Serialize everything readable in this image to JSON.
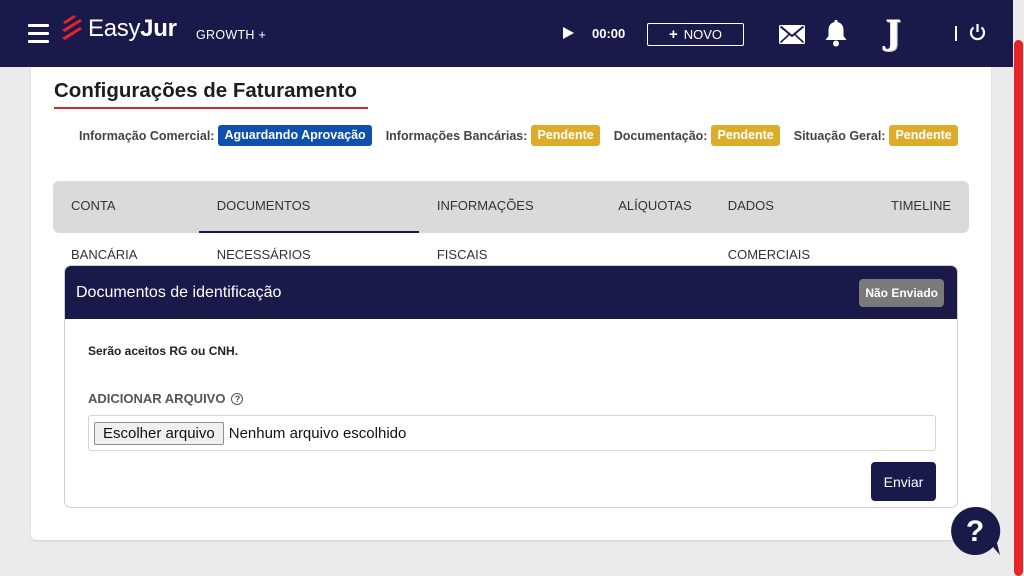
{
  "header": {
    "brand_light": "Easy",
    "brand_bold": "Jur",
    "plan": "GROWTH +",
    "timer": "00:00",
    "new_button": "NOVO",
    "new_plus": "+",
    "avatar_letter": "J",
    "icons": [
      "menu-icon",
      "play-icon",
      "mail-icon",
      "bell-icon",
      "power-icon"
    ]
  },
  "page": {
    "title": "Configurações de Faturamento"
  },
  "statuses": [
    {
      "label": "Informação Comercial:",
      "value": "Aguardando Aprovação",
      "color": "#0f4fad"
    },
    {
      "label": "Informações Bancárias:",
      "value": "Pendente",
      "color": "#ddac2b"
    },
    {
      "label": "Documentação:",
      "value": "Pendente",
      "color": "#ddac2b"
    },
    {
      "label": "Situação Geral:",
      "value": "Pendente",
      "color": "#ddac2b"
    }
  ],
  "tabs": [
    {
      "label": "CONTA BANCÁRIA"
    },
    {
      "label": "DOCUMENTOS NECESSÁRIOS",
      "active": true
    },
    {
      "label": "INFORMAÇÕES FISCAIS"
    },
    {
      "label": "ALÍQUOTAS"
    },
    {
      "label": "DADOS COMERCIAIS"
    },
    {
      "label": "TIMELINE"
    }
  ],
  "panel": {
    "title": "Documentos de identificação",
    "status": "Não Enviado",
    "note": "Serão aceitos RG ou CNH.",
    "add_label": "ADICIONAR ARQUIVO",
    "help_glyph": "?",
    "file_button": "Escolher arquivo",
    "file_status": "Nenhum arquivo escolhido",
    "send_button": "Enviar"
  },
  "colors": {
    "navy": "#191a4a",
    "accent_red": "#d9262a",
    "badge_blue": "#0f4fad",
    "badge_yellow": "#ddac2b",
    "badge_gray": "#7a7a7a"
  }
}
